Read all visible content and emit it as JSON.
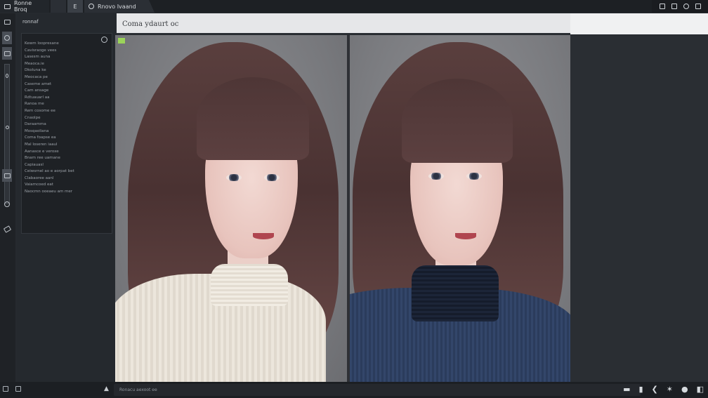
{
  "tabs": [
    {
      "label": "Ronne Broq"
    },
    {
      "label": ""
    },
    {
      "label": "E"
    },
    {
      "label": "Rnovo Ivaand"
    }
  ],
  "window_controls": [
    "new-tab-icon",
    "copy-icon",
    "link-icon",
    "restore-icon"
  ],
  "title_bar": {
    "title": "Coma ydaurt oc"
  },
  "side_panel": {
    "label": "ronnaf",
    "items": [
      "Kewm loopresane",
      "Cavisraoge vees",
      "Lasesm auna",
      "Meaoca.ie",
      "Dkoluna ke",
      "Meocaca pe",
      "Caseme amet",
      "Cam ansage",
      "Rdtuauarl aa",
      "Ranoa me",
      "Rem cosome ee",
      "Cnaolpe",
      "Daraamma",
      "Mosqaoliana",
      "Coma foapse ea",
      "Mal loseren iaaul",
      "Aanasce e veroxe",
      "Bnam ree uamane",
      "Capiauasl",
      "Ceiwsrnel ao e aorpat bet",
      "Clabaoree aanl",
      "Vaiamcoed eat",
      "Naocmn ooeaeu am mer"
    ]
  },
  "status_text": "Ronacu aexoot ee"
}
